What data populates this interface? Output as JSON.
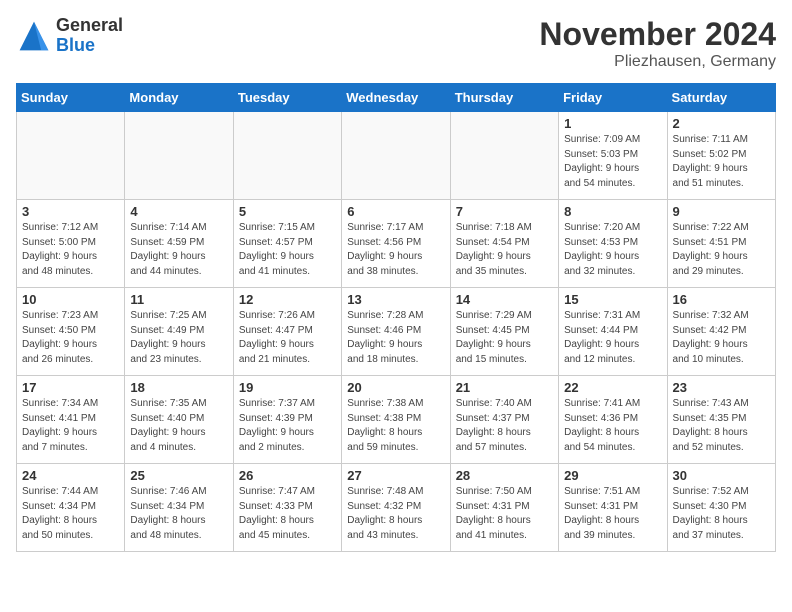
{
  "logo": {
    "general": "General",
    "blue": "Blue"
  },
  "title": "November 2024",
  "location": "Pliezhausen, Germany",
  "headers": [
    "Sunday",
    "Monday",
    "Tuesday",
    "Wednesday",
    "Thursday",
    "Friday",
    "Saturday"
  ],
  "weeks": [
    [
      {
        "day": "",
        "info": ""
      },
      {
        "day": "",
        "info": ""
      },
      {
        "day": "",
        "info": ""
      },
      {
        "day": "",
        "info": ""
      },
      {
        "day": "",
        "info": ""
      },
      {
        "day": "1",
        "info": "Sunrise: 7:09 AM\nSunset: 5:03 PM\nDaylight: 9 hours\nand 54 minutes."
      },
      {
        "day": "2",
        "info": "Sunrise: 7:11 AM\nSunset: 5:02 PM\nDaylight: 9 hours\nand 51 minutes."
      }
    ],
    [
      {
        "day": "3",
        "info": "Sunrise: 7:12 AM\nSunset: 5:00 PM\nDaylight: 9 hours\nand 48 minutes."
      },
      {
        "day": "4",
        "info": "Sunrise: 7:14 AM\nSunset: 4:59 PM\nDaylight: 9 hours\nand 44 minutes."
      },
      {
        "day": "5",
        "info": "Sunrise: 7:15 AM\nSunset: 4:57 PM\nDaylight: 9 hours\nand 41 minutes."
      },
      {
        "day": "6",
        "info": "Sunrise: 7:17 AM\nSunset: 4:56 PM\nDaylight: 9 hours\nand 38 minutes."
      },
      {
        "day": "7",
        "info": "Sunrise: 7:18 AM\nSunset: 4:54 PM\nDaylight: 9 hours\nand 35 minutes."
      },
      {
        "day": "8",
        "info": "Sunrise: 7:20 AM\nSunset: 4:53 PM\nDaylight: 9 hours\nand 32 minutes."
      },
      {
        "day": "9",
        "info": "Sunrise: 7:22 AM\nSunset: 4:51 PM\nDaylight: 9 hours\nand 29 minutes."
      }
    ],
    [
      {
        "day": "10",
        "info": "Sunrise: 7:23 AM\nSunset: 4:50 PM\nDaylight: 9 hours\nand 26 minutes."
      },
      {
        "day": "11",
        "info": "Sunrise: 7:25 AM\nSunset: 4:49 PM\nDaylight: 9 hours\nand 23 minutes."
      },
      {
        "day": "12",
        "info": "Sunrise: 7:26 AM\nSunset: 4:47 PM\nDaylight: 9 hours\nand 21 minutes."
      },
      {
        "day": "13",
        "info": "Sunrise: 7:28 AM\nSunset: 4:46 PM\nDaylight: 9 hours\nand 18 minutes."
      },
      {
        "day": "14",
        "info": "Sunrise: 7:29 AM\nSunset: 4:45 PM\nDaylight: 9 hours\nand 15 minutes."
      },
      {
        "day": "15",
        "info": "Sunrise: 7:31 AM\nSunset: 4:44 PM\nDaylight: 9 hours\nand 12 minutes."
      },
      {
        "day": "16",
        "info": "Sunrise: 7:32 AM\nSunset: 4:42 PM\nDaylight: 9 hours\nand 10 minutes."
      }
    ],
    [
      {
        "day": "17",
        "info": "Sunrise: 7:34 AM\nSunset: 4:41 PM\nDaylight: 9 hours\nand 7 minutes."
      },
      {
        "day": "18",
        "info": "Sunrise: 7:35 AM\nSunset: 4:40 PM\nDaylight: 9 hours\nand 4 minutes."
      },
      {
        "day": "19",
        "info": "Sunrise: 7:37 AM\nSunset: 4:39 PM\nDaylight: 9 hours\nand 2 minutes."
      },
      {
        "day": "20",
        "info": "Sunrise: 7:38 AM\nSunset: 4:38 PM\nDaylight: 8 hours\nand 59 minutes."
      },
      {
        "day": "21",
        "info": "Sunrise: 7:40 AM\nSunset: 4:37 PM\nDaylight: 8 hours\nand 57 minutes."
      },
      {
        "day": "22",
        "info": "Sunrise: 7:41 AM\nSunset: 4:36 PM\nDaylight: 8 hours\nand 54 minutes."
      },
      {
        "day": "23",
        "info": "Sunrise: 7:43 AM\nSunset: 4:35 PM\nDaylight: 8 hours\nand 52 minutes."
      }
    ],
    [
      {
        "day": "24",
        "info": "Sunrise: 7:44 AM\nSunset: 4:34 PM\nDaylight: 8 hours\nand 50 minutes."
      },
      {
        "day": "25",
        "info": "Sunrise: 7:46 AM\nSunset: 4:34 PM\nDaylight: 8 hours\nand 48 minutes."
      },
      {
        "day": "26",
        "info": "Sunrise: 7:47 AM\nSunset: 4:33 PM\nDaylight: 8 hours\nand 45 minutes."
      },
      {
        "day": "27",
        "info": "Sunrise: 7:48 AM\nSunset: 4:32 PM\nDaylight: 8 hours\nand 43 minutes."
      },
      {
        "day": "28",
        "info": "Sunrise: 7:50 AM\nSunset: 4:31 PM\nDaylight: 8 hours\nand 41 minutes."
      },
      {
        "day": "29",
        "info": "Sunrise: 7:51 AM\nSunset: 4:31 PM\nDaylight: 8 hours\nand 39 minutes."
      },
      {
        "day": "30",
        "info": "Sunrise: 7:52 AM\nSunset: 4:30 PM\nDaylight: 8 hours\nand 37 minutes."
      }
    ]
  ]
}
